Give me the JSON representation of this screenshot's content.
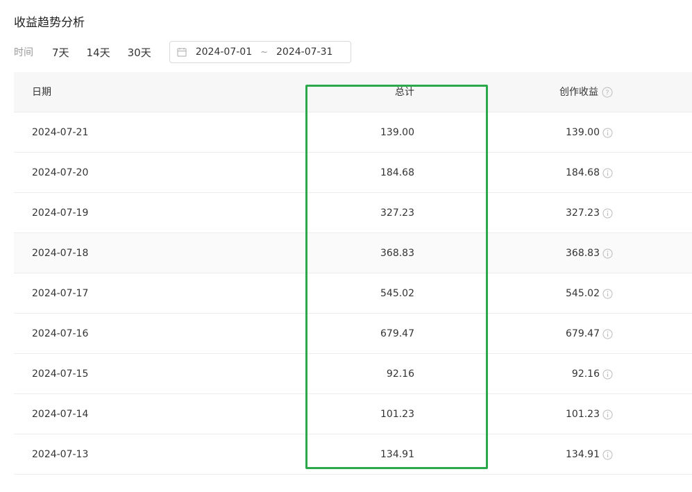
{
  "page": {
    "title": "收益趋势分析"
  },
  "filter": {
    "label": "时间",
    "ranges": [
      "7天",
      "14天",
      "30天"
    ],
    "start_date": "2024-07-01",
    "separator": "~",
    "end_date": "2024-07-31",
    "icon": "calendar-icon"
  },
  "table": {
    "headers": {
      "date": "日期",
      "total": "总计",
      "income": "创作收益"
    },
    "rows": [
      {
        "date": "2024-07-21",
        "total": "139.00",
        "income": "139.00"
      },
      {
        "date": "2024-07-20",
        "total": "184.68",
        "income": "184.68"
      },
      {
        "date": "2024-07-19",
        "total": "327.23",
        "income": "327.23"
      },
      {
        "date": "2024-07-18",
        "total": "368.83",
        "income": "368.83"
      },
      {
        "date": "2024-07-17",
        "total": "545.02",
        "income": "545.02"
      },
      {
        "date": "2024-07-16",
        "total": "679.47",
        "income": "679.47"
      },
      {
        "date": "2024-07-15",
        "total": "92.16",
        "income": "92.16"
      },
      {
        "date": "2024-07-14",
        "total": "101.23",
        "income": "101.23"
      },
      {
        "date": "2024-07-13",
        "total": "134.91",
        "income": "134.91"
      }
    ]
  },
  "colors": {
    "highlight_border": "#2aa84a",
    "hover_row": "#fafafa",
    "header_bg": "#f7f7f7"
  }
}
